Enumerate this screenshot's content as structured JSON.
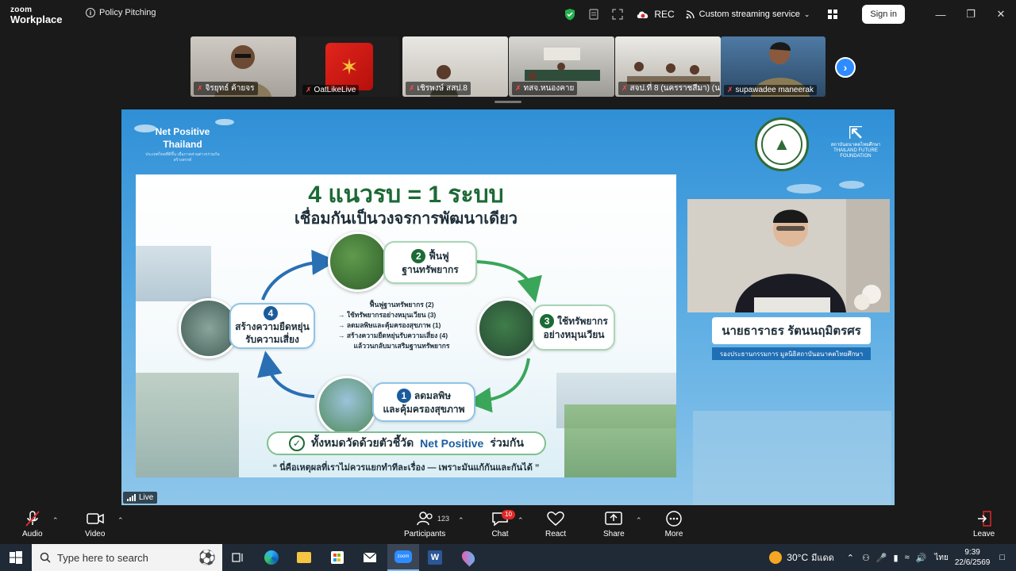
{
  "app": {
    "logo_line1": "zoom",
    "logo_line2": "Workplace",
    "meeting_title": "Policy Pitching",
    "recording_label": "REC",
    "streaming_label": "Custom streaming service",
    "signin_label": "Sign in"
  },
  "gallery": [
    {
      "name": "จิรยุทธ์ ค้ายจร"
    },
    {
      "name": "OatLikeLive"
    },
    {
      "name": "เชิรพงษ์ สสป.8"
    },
    {
      "name": "ทสจ.หนองคาย"
    },
    {
      "name": "สจป.ที่ 8 (นครราชสีมา) (น..."
    },
    {
      "name": "supawadee maneerak"
    }
  ],
  "share": {
    "np_title_1": "Net Positive",
    "np_title_2": "Thailand",
    "np_subtitle": "ประเทศไทยที่ดีขึ้น เมื่อภาคส่วนต่างๆร่วมกันสร้างสรรค์",
    "tff_name": "สถาบันอนาคตไทยศึกษา",
    "tff_en": "THAILAND FUTURE",
    "tff_en2": "FOUNDATION",
    "slide": {
      "title": "4 แนวรบ = 1 ระบบ",
      "subtitle": "เชื่อมกันเป็นวงจรการพัฒนาเดียว",
      "node2_num": "2",
      "node2_line1": "ฟื้นฟู",
      "node2_line2": "ฐานทรัพยากร",
      "node3_num": "3",
      "node3_line1": "ใช้ทรัพยากร",
      "node3_line2": "อย่างหมุนเวียน",
      "node1_num": "1",
      "node1_line1": "ลดมลพิษ",
      "node1_line2": "และคุ้มครองสุขภาพ",
      "node4_num": "4",
      "node4_line1": "สร้างความยืดหยุ่น",
      "node4_line2": "รับความเสี่ยง",
      "flow": [
        "ฟื้นฟูฐานทรัพยากร (2)",
        "→ ใช้ทรัพยากรอย่างหมุนเวียน (3)",
        "→ ลดมลพิษและคุ้มครองสุขภาพ (1)",
        "→ สร้างความยืดหยุ่นรับความเสี่ยง (4)",
        "แล้ววนกลับมาเสริมฐานทรัพยากร"
      ],
      "banner_prefix": "ทั้งหมดวัดด้วยตัวชี้วัด",
      "banner_np": "Net Positive",
      "banner_suffix": "ร่วมกัน",
      "quote": "“ นี่คือเหตุผลที่เราไม่ควรแยกทำทีละเรื่อง — เพราะมันแก้กันและกันได้ ”"
    },
    "speaker_name": "นายธาราธร รัตนนฤมิตรศร",
    "speaker_title": "รองประธานกรรมการ มูลนิธิสถาบันอนาคตไทยศึกษา",
    "live_label": "Live"
  },
  "controls": {
    "audio": "Audio",
    "video": "Video",
    "participants": "Participants",
    "participants_count": "123",
    "chat": "Chat",
    "chat_badge": "10",
    "react": "React",
    "share": "Share",
    "more": "More",
    "leave": "Leave"
  },
  "taskbar": {
    "search_placeholder": "Type here to search",
    "weather": "30°C",
    "weather_desc": "มีแดด",
    "lang": "ไทย",
    "time": "9:39",
    "date": "22/6/2569"
  },
  "colors": {
    "zoom_blue": "#2d8cff",
    "rec_red": "#e02828",
    "slide_green": "#1c6a35"
  }
}
